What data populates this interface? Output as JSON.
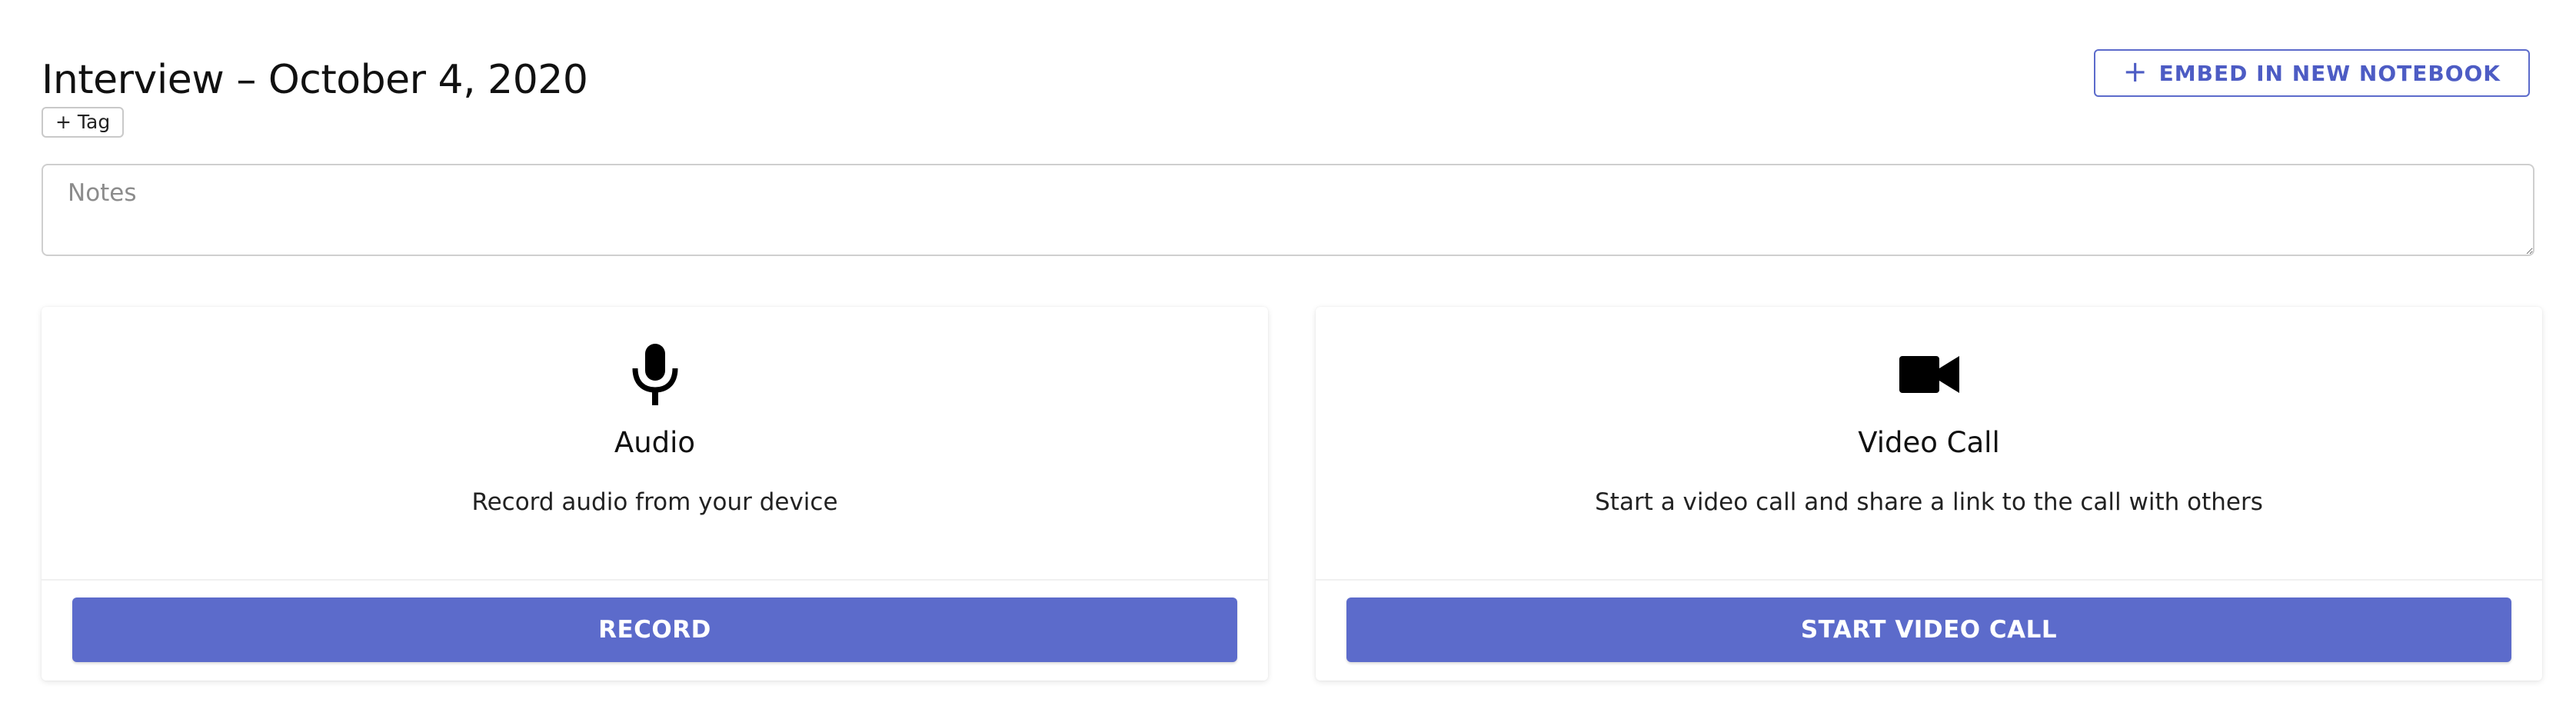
{
  "header": {
    "title": "Interview – October 4, 2020",
    "tag_button": "+ Tag",
    "embed_button": "EMBED IN NEW NOTEBOOK",
    "embed_icon": "plus-icon"
  },
  "notes": {
    "placeholder": "Notes",
    "value": ""
  },
  "cards": [
    {
      "icon": "microphone-icon",
      "title": "Audio",
      "description": "Record audio from your device",
      "action_label": "RECORD"
    },
    {
      "icon": "video-camera-icon",
      "title": "Video Call",
      "description": "Start a video call and share a link to the call with others",
      "action_label": "START VIDEO CALL"
    }
  ],
  "colors": {
    "accent": "#5c6bcb",
    "text": "#111111",
    "border": "#cfcfcf"
  }
}
